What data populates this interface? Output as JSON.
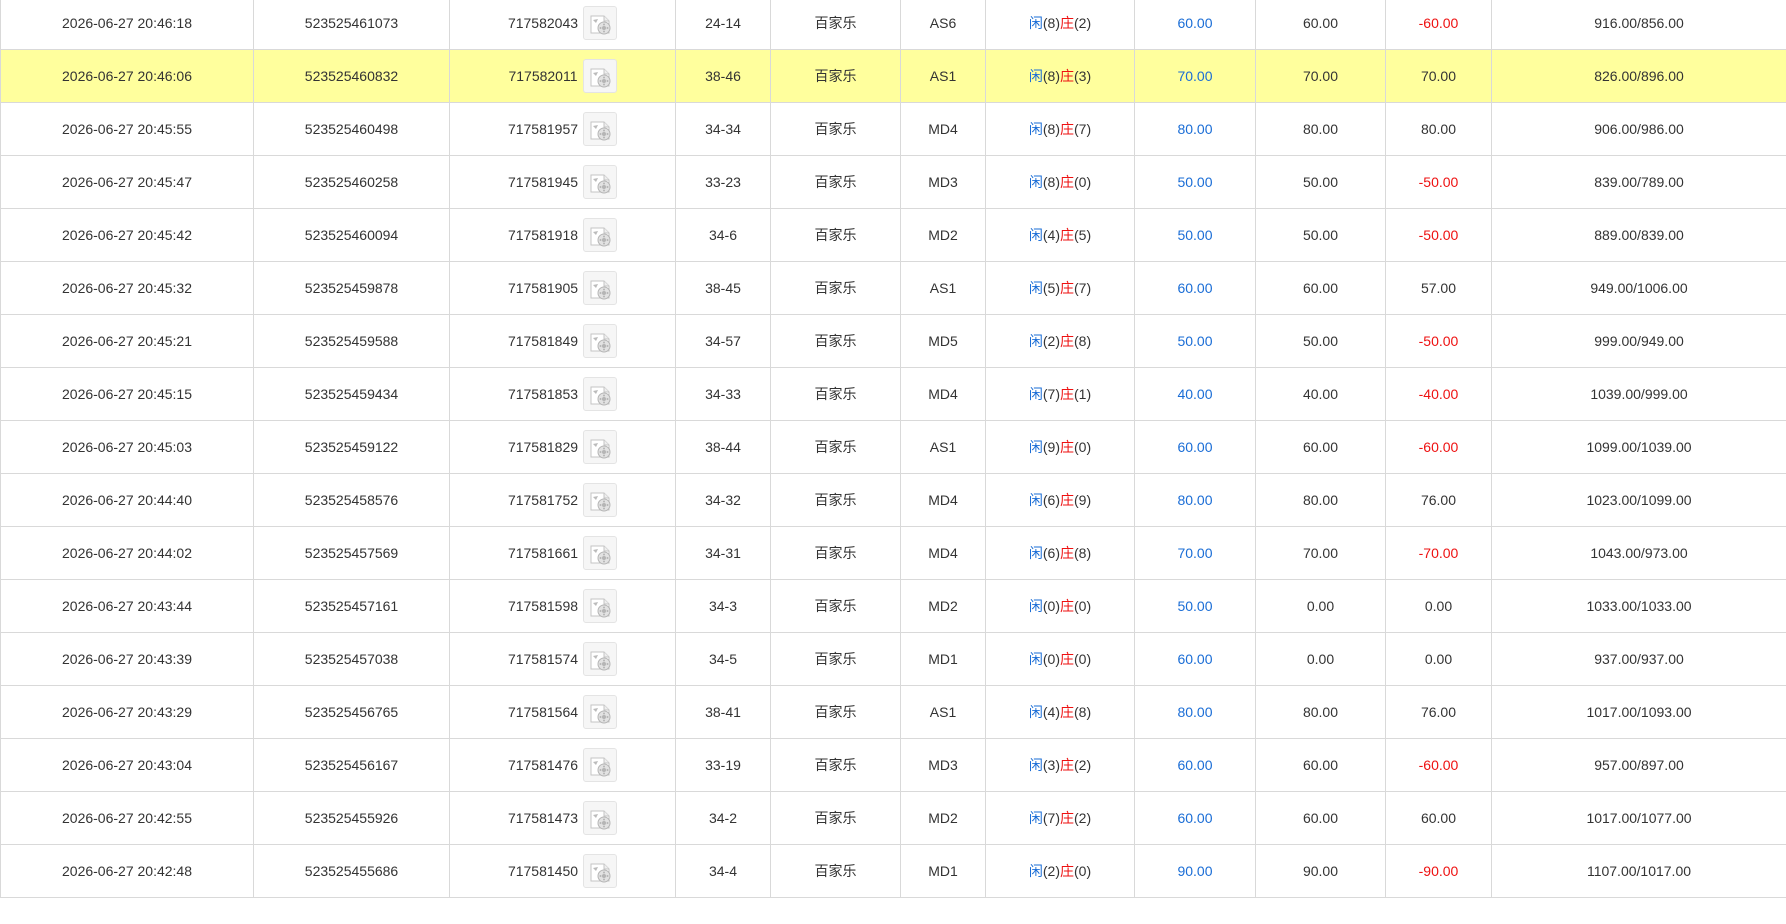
{
  "icons": {
    "video": "video-replay-icon"
  },
  "colors": {
    "blue": "#1a6dd6",
    "red": "#ee1111",
    "highlight": "#ffff9d"
  },
  "rows": [
    {
      "time": "2026-06-27 20:46:18",
      "bet_id": "523525461073",
      "round_id": "717582043",
      "seat": "24-14",
      "game": "百家乐",
      "table": "AS6",
      "player_label": "闲",
      "player_score": "(8)",
      "banker_label": "庄",
      "banker_score": "(2)",
      "bet": "60.00",
      "valid": "60.00",
      "winloss": "-60.00",
      "wl_color": "red",
      "balance": "916.00/856.00",
      "highlight": false
    },
    {
      "time": "2026-06-27 20:46:06",
      "bet_id": "523525460832",
      "round_id": "717582011",
      "seat": "38-46",
      "game": "百家乐",
      "table": "AS1",
      "player_label": "闲",
      "player_score": "(8)",
      "banker_label": "庄",
      "banker_score": "(3)",
      "bet": "70.00",
      "valid": "70.00",
      "winloss": "70.00",
      "wl_color": "black",
      "balance": "826.00/896.00",
      "highlight": true
    },
    {
      "time": "2026-06-27 20:45:55",
      "bet_id": "523525460498",
      "round_id": "717581957",
      "seat": "34-34",
      "game": "百家乐",
      "table": "MD4",
      "player_label": "闲",
      "player_score": "(8)",
      "banker_label": "庄",
      "banker_score": "(7)",
      "bet": "80.00",
      "valid": "80.00",
      "winloss": "80.00",
      "wl_color": "black",
      "balance": "906.00/986.00",
      "highlight": false
    },
    {
      "time": "2026-06-27 20:45:47",
      "bet_id": "523525460258",
      "round_id": "717581945",
      "seat": "33-23",
      "game": "百家乐",
      "table": "MD3",
      "player_label": "闲",
      "player_score": "(8)",
      "banker_label": "庄",
      "banker_score": "(0)",
      "bet": "50.00",
      "valid": "50.00",
      "winloss": "-50.00",
      "wl_color": "red",
      "balance": "839.00/789.00",
      "highlight": false
    },
    {
      "time": "2026-06-27 20:45:42",
      "bet_id": "523525460094",
      "round_id": "717581918",
      "seat": "34-6",
      "game": "百家乐",
      "table": "MD2",
      "player_label": "闲",
      "player_score": "(4)",
      "banker_label": "庄",
      "banker_score": "(5)",
      "bet": "50.00",
      "valid": "50.00",
      "winloss": "-50.00",
      "wl_color": "red",
      "balance": "889.00/839.00",
      "highlight": false
    },
    {
      "time": "2026-06-27 20:45:32",
      "bet_id": "523525459878",
      "round_id": "717581905",
      "seat": "38-45",
      "game": "百家乐",
      "table": "AS1",
      "player_label": "闲",
      "player_score": "(5)",
      "banker_label": "庄",
      "banker_score": "(7)",
      "bet": "60.00",
      "valid": "60.00",
      "winloss": "57.00",
      "wl_color": "black",
      "balance": "949.00/1006.00",
      "highlight": false
    },
    {
      "time": "2026-06-27 20:45:21",
      "bet_id": "523525459588",
      "round_id": "717581849",
      "seat": "34-57",
      "game": "百家乐",
      "table": "MD5",
      "player_label": "闲",
      "player_score": "(2)",
      "banker_label": "庄",
      "banker_score": "(8)",
      "bet": "50.00",
      "valid": "50.00",
      "winloss": "-50.00",
      "wl_color": "red",
      "balance": "999.00/949.00",
      "highlight": false
    },
    {
      "time": "2026-06-27 20:45:15",
      "bet_id": "523525459434",
      "round_id": "717581853",
      "seat": "34-33",
      "game": "百家乐",
      "table": "MD4",
      "player_label": "闲",
      "player_score": "(7)",
      "banker_label": "庄",
      "banker_score": "(1)",
      "bet": "40.00",
      "valid": "40.00",
      "winloss": "-40.00",
      "wl_color": "red",
      "balance": "1039.00/999.00",
      "highlight": false
    },
    {
      "time": "2026-06-27 20:45:03",
      "bet_id": "523525459122",
      "round_id": "717581829",
      "seat": "38-44",
      "game": "百家乐",
      "table": "AS1",
      "player_label": "闲",
      "player_score": "(9)",
      "banker_label": "庄",
      "banker_score": "(0)",
      "bet": "60.00",
      "valid": "60.00",
      "winloss": "-60.00",
      "wl_color": "red",
      "balance": "1099.00/1039.00",
      "highlight": false
    },
    {
      "time": "2026-06-27 20:44:40",
      "bet_id": "523525458576",
      "round_id": "717581752",
      "seat": "34-32",
      "game": "百家乐",
      "table": "MD4",
      "player_label": "闲",
      "player_score": "(6)",
      "banker_label": "庄",
      "banker_score": "(9)",
      "bet": "80.00",
      "valid": "80.00",
      "winloss": "76.00",
      "wl_color": "black",
      "balance": "1023.00/1099.00",
      "highlight": false
    },
    {
      "time": "2026-06-27 20:44:02",
      "bet_id": "523525457569",
      "round_id": "717581661",
      "seat": "34-31",
      "game": "百家乐",
      "table": "MD4",
      "player_label": "闲",
      "player_score": "(6)",
      "banker_label": "庄",
      "banker_score": "(8)",
      "bet": "70.00",
      "valid": "70.00",
      "winloss": "-70.00",
      "wl_color": "red",
      "balance": "1043.00/973.00",
      "highlight": false
    },
    {
      "time": "2026-06-27 20:43:44",
      "bet_id": "523525457161",
      "round_id": "717581598",
      "seat": "34-3",
      "game": "百家乐",
      "table": "MD2",
      "player_label": "闲",
      "player_score": "(0)",
      "banker_label": "庄",
      "banker_score": "(0)",
      "bet": "50.00",
      "valid": "0.00",
      "winloss": "0.00",
      "wl_color": "black",
      "balance": "1033.00/1033.00",
      "highlight": false
    },
    {
      "time": "2026-06-27 20:43:39",
      "bet_id": "523525457038",
      "round_id": "717581574",
      "seat": "34-5",
      "game": "百家乐",
      "table": "MD1",
      "player_label": "闲",
      "player_score": "(0)",
      "banker_label": "庄",
      "banker_score": "(0)",
      "bet": "60.00",
      "valid": "0.00",
      "winloss": "0.00",
      "wl_color": "black",
      "balance": "937.00/937.00",
      "highlight": false
    },
    {
      "time": "2026-06-27 20:43:29",
      "bet_id": "523525456765",
      "round_id": "717581564",
      "seat": "38-41",
      "game": "百家乐",
      "table": "AS1",
      "player_label": "闲",
      "player_score": "(4)",
      "banker_label": "庄",
      "banker_score": "(8)",
      "bet": "80.00",
      "valid": "80.00",
      "winloss": "76.00",
      "wl_color": "black",
      "balance": "1017.00/1093.00",
      "highlight": false
    },
    {
      "time": "2026-06-27 20:43:04",
      "bet_id": "523525456167",
      "round_id": "717581476",
      "seat": "33-19",
      "game": "百家乐",
      "table": "MD3",
      "player_label": "闲",
      "player_score": "(3)",
      "banker_label": "庄",
      "banker_score": "(2)",
      "bet": "60.00",
      "valid": "60.00",
      "winloss": "-60.00",
      "wl_color": "red",
      "balance": "957.00/897.00",
      "highlight": false
    },
    {
      "time": "2026-06-27 20:42:55",
      "bet_id": "523525455926",
      "round_id": "717581473",
      "seat": "34-2",
      "game": "百家乐",
      "table": "MD2",
      "player_label": "闲",
      "player_score": "(7)",
      "banker_label": "庄",
      "banker_score": "(2)",
      "bet": "60.00",
      "valid": "60.00",
      "winloss": "60.00",
      "wl_color": "black",
      "balance": "1017.00/1077.00",
      "highlight": false
    },
    {
      "time": "2026-06-27 20:42:48",
      "bet_id": "523525455686",
      "round_id": "717581450",
      "seat": "34-4",
      "game": "百家乐",
      "table": "MD1",
      "player_label": "闲",
      "player_score": "(2)",
      "banker_label": "庄",
      "banker_score": "(0)",
      "bet": "90.00",
      "valid": "90.00",
      "winloss": "-90.00",
      "wl_color": "red",
      "balance": "1107.00/1017.00",
      "highlight": false
    }
  ]
}
